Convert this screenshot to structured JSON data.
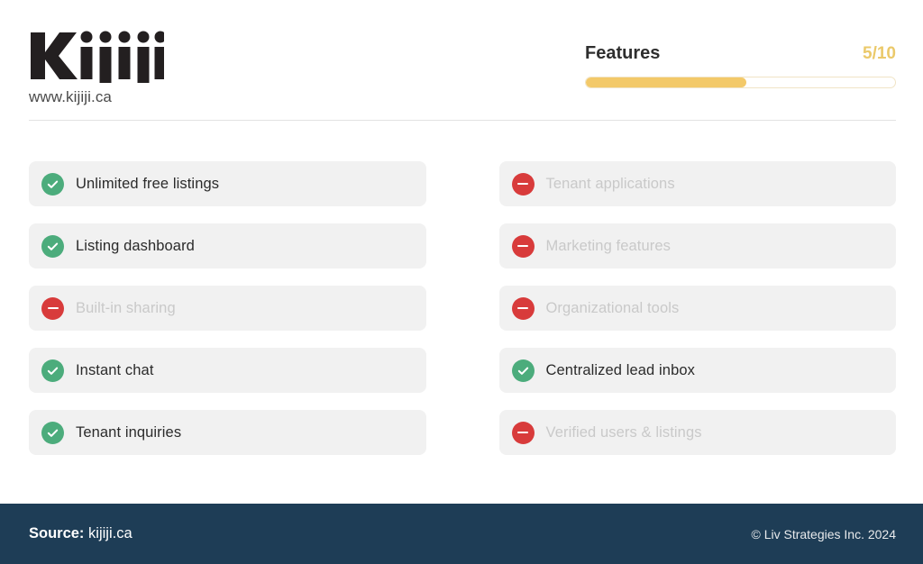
{
  "brand": {
    "logo_text": "Kijiji",
    "logo_icon": "kijiji-wordmark",
    "url": "www.kijiji.ca"
  },
  "score": {
    "title": "Features",
    "value": "5/10",
    "progress_percent": 52,
    "fill_color": "#f3c969",
    "value_color": "#ebc96a"
  },
  "features": {
    "left": [
      {
        "label": "Unlimited free listings",
        "status": "available",
        "icon": "check-circle-icon"
      },
      {
        "label": "Listing dashboard",
        "status": "available",
        "icon": "check-circle-icon"
      },
      {
        "label": "Built-in sharing",
        "status": "unavailable",
        "icon": "minus-circle-icon"
      },
      {
        "label": "Instant chat",
        "status": "available",
        "icon": "check-circle-icon"
      },
      {
        "label": "Tenant inquiries",
        "status": "available",
        "icon": "check-circle-icon"
      }
    ],
    "right": [
      {
        "label": "Tenant applications",
        "status": "unavailable",
        "icon": "minus-circle-icon"
      },
      {
        "label": "Marketing features",
        "status": "unavailable",
        "icon": "minus-circle-icon"
      },
      {
        "label": "Organizational tools",
        "status": "unavailable",
        "icon": "minus-circle-icon"
      },
      {
        "label": "Centralized lead inbox",
        "status": "available",
        "icon": "check-circle-icon"
      },
      {
        "label": "Verified users & listings",
        "status": "unavailable",
        "icon": "minus-circle-icon"
      }
    ]
  },
  "footer": {
    "source_label": "Source:",
    "source_value": "kijiji.ca",
    "copyright": "© Liv Strategies Inc. 2024",
    "background_color": "#1e3d56"
  }
}
